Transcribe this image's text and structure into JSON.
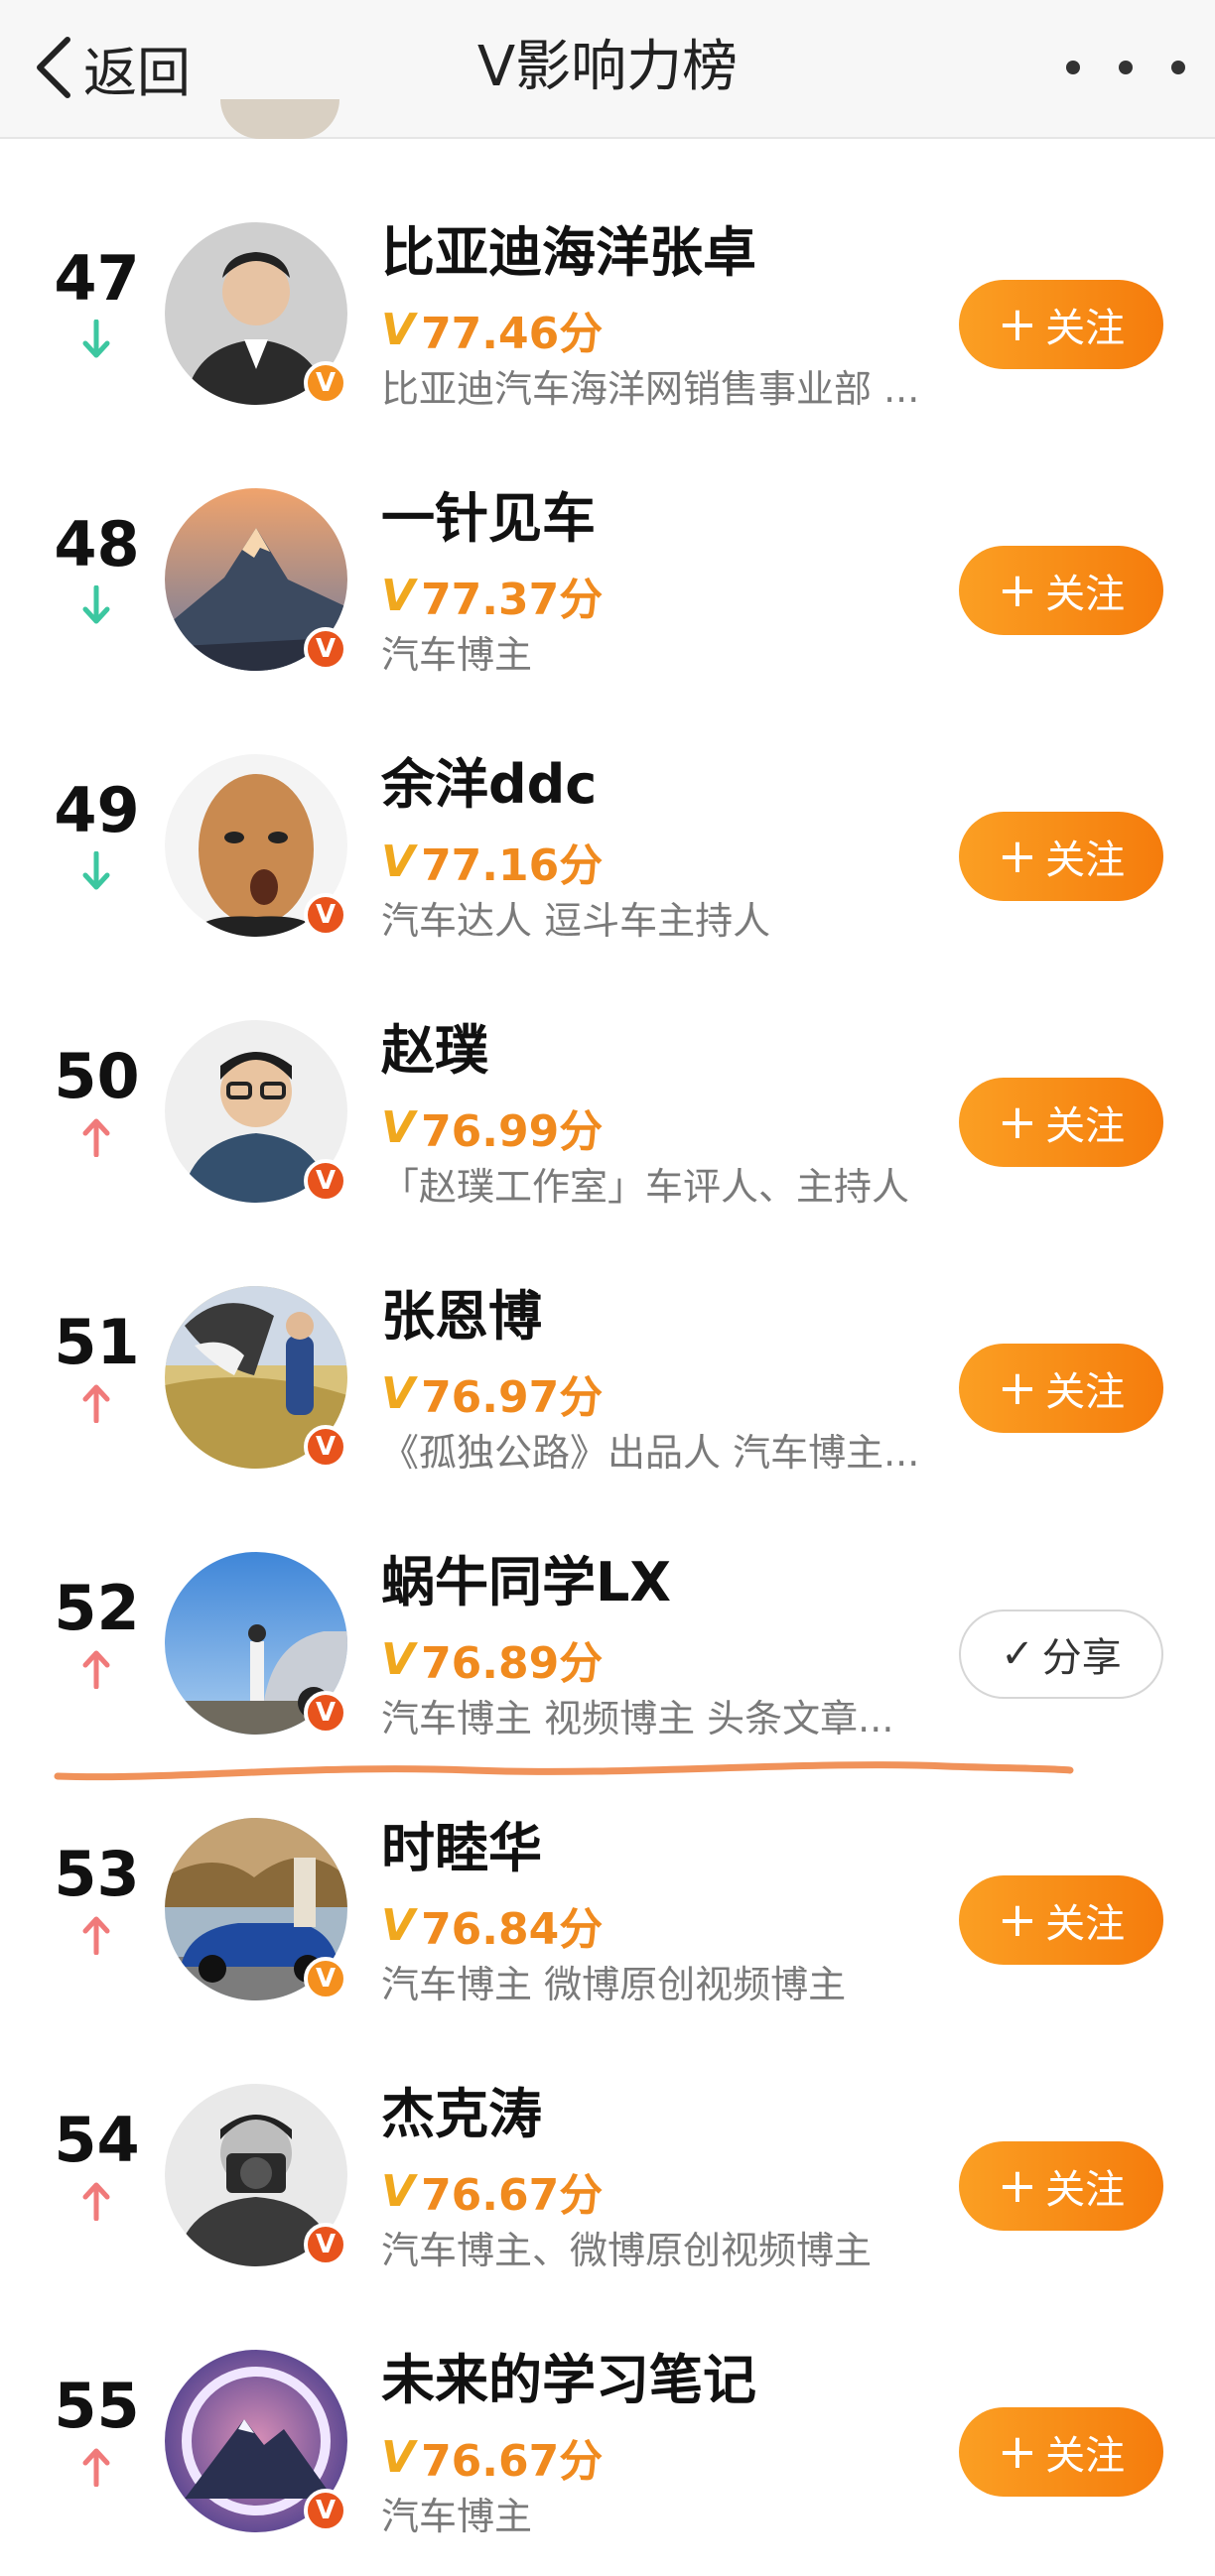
{
  "header": {
    "back_label": "返回",
    "title": "V影响力榜"
  },
  "list": [
    {
      "rank": "47",
      "trend": "down",
      "name": "比亚迪海洋张卓",
      "v_mark": "V",
      "score": "77.46分",
      "desc": "比亚迪汽车海洋网销售事业部 ...",
      "button": "关注",
      "followed": false,
      "badge": "orange",
      "avatar_icon": "man-in-suit-avatar"
    },
    {
      "rank": "48",
      "trend": "down",
      "name": "一针见车",
      "v_mark": "V",
      "score": "77.37分",
      "desc": "汽车博主",
      "button": "关注",
      "followed": false,
      "badge": "red",
      "avatar_icon": "mountain-avatar"
    },
    {
      "rank": "49",
      "trend": "down",
      "name": "余洋ddc",
      "v_mark": "V",
      "score": "77.16分",
      "desc": "汽车达人 逗斗车主持人",
      "button": "关注",
      "followed": false,
      "badge": "red",
      "avatar_icon": "cartoon-face-avatar"
    },
    {
      "rank": "50",
      "trend": "up",
      "name": "赵璞",
      "v_mark": "V",
      "score": "76.99分",
      "desc": "「赵璞工作室」车评人、主持人",
      "button": "关注",
      "followed": false,
      "badge": "red",
      "avatar_icon": "man-with-glasses-avatar"
    },
    {
      "rank": "51",
      "trend": "up",
      "name": "张恩博",
      "v_mark": "V",
      "score": "76.97分",
      "desc": "《孤独公路》出品人 汽车博主...",
      "button": "关注",
      "followed": false,
      "badge": "red",
      "avatar_icon": "parachute-avatar"
    },
    {
      "rank": "52",
      "trend": "up",
      "name": "蜗牛同学LX",
      "v_mark": "V",
      "score": "76.89分",
      "desc": "汽车博主 视频博主 头条文章...",
      "button": "分享",
      "followed": true,
      "badge": "red",
      "avatar_icon": "car-sky-avatar"
    },
    {
      "rank": "53",
      "trend": "up",
      "name": "时睦华",
      "v_mark": "V",
      "score": "76.84分",
      "desc": "汽车博主 微博原创视频博主",
      "button": "关注",
      "followed": false,
      "badge": "orange",
      "avatar_icon": "blue-car-avatar"
    },
    {
      "rank": "54",
      "trend": "up",
      "name": "杰克涛",
      "v_mark": "V",
      "score": "76.67分",
      "desc": "汽车博主、微博原创视频博主",
      "button": "关注",
      "followed": false,
      "badge": "red",
      "avatar_icon": "camera-man-avatar"
    },
    {
      "rank": "55",
      "trend": "up",
      "name": "未来的学习笔记",
      "v_mark": "V",
      "score": "76.67分",
      "desc": "汽车博主",
      "button": "关注",
      "followed": false,
      "badge": "red",
      "avatar_icon": "purple-mountain-avatar"
    }
  ],
  "colors": {
    "accent_orange": "#f57c0c",
    "score_orange": "#f08a1e",
    "trend_up": "#f07a7a",
    "trend_down": "#3cc7a0",
    "annotation_line": "#f0925a"
  }
}
